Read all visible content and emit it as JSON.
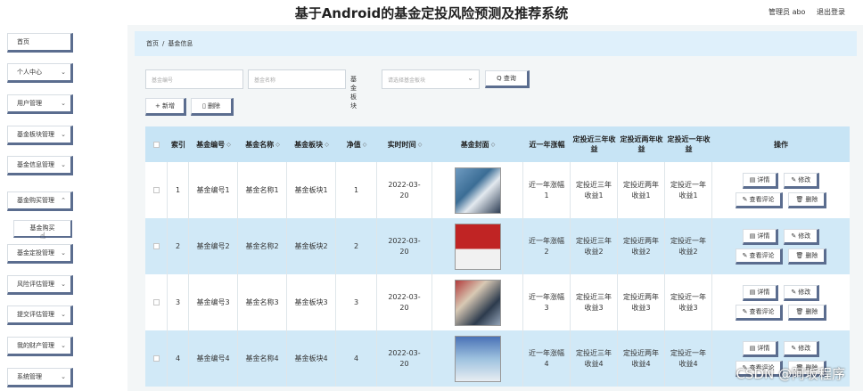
{
  "header": {
    "title": "基于Android的基金定投风险预测及推荐系统",
    "user_label": "管理员 abo",
    "logout_label": "退出登录"
  },
  "sidebar": {
    "items": [
      {
        "label": "首页"
      },
      {
        "label": "个人中心",
        "chevron": "⌄"
      },
      {
        "label": "用户管理",
        "chevron": "⌄"
      },
      {
        "label": "基金板块管理",
        "chevron": "⌄"
      },
      {
        "label": "基金信息管理",
        "chevron": "⌄"
      },
      {
        "label": "基金购买管理",
        "chevron": "⌃"
      },
      {
        "label": "基金定投管理",
        "chevron": "⌄"
      },
      {
        "label": "风险评估管理",
        "chevron": "⌄"
      },
      {
        "label": "提交评估管理",
        "chevron": "⌄"
      },
      {
        "label": "我的财产管理",
        "chevron": "⌄"
      },
      {
        "label": "系统管理",
        "chevron": "⌄"
      }
    ],
    "sub_item": "基金购买"
  },
  "breadcrumb": {
    "home": "首页",
    "sep": "/",
    "current": "基金信息"
  },
  "search": {
    "code_placeholder": "基金编号",
    "name_placeholder": "基金名称",
    "sector_label": "基金板块",
    "sector_placeholder": "请选择基金板块",
    "query_label": "Q 查询"
  },
  "actions": {
    "add_label": "+ 新增",
    "delete_label": "▯ 删除"
  },
  "table": {
    "headers": {
      "index": "索引",
      "code": "基金编号",
      "name": "基金名称",
      "sector": "基金板块",
      "nav": "净值",
      "time": "实时时间",
      "cover": "基金封面",
      "one_year": "近一年涨幅",
      "three_year": "定投近三年收益",
      "two_year": "定投近两年收益",
      "last_year": "定投近一年收益",
      "ops": "操作"
    },
    "sort_icon": "◇",
    "rows": [
      {
        "index": "1",
        "code": "基金编号1",
        "name": "基金名称1",
        "sector": "基金板块1",
        "nav": "1",
        "time": "2022-03-20",
        "one_year": "近一年涨幅1",
        "three_year": "定投近三年收益1",
        "two_year": "定投近两年收益1",
        "last_year": "定投近一年收益1"
      },
      {
        "index": "2",
        "code": "基金编号2",
        "name": "基金名称2",
        "sector": "基金板块2",
        "nav": "2",
        "time": "2022-03-20",
        "one_year": "近一年涨幅2",
        "three_year": "定投近三年收益2",
        "two_year": "定投近两年收益2",
        "last_year": "定投近一年收益2"
      },
      {
        "index": "3",
        "code": "基金编号3",
        "name": "基金名称3",
        "sector": "基金板块3",
        "nav": "3",
        "time": "2022-03-20",
        "one_year": "近一年涨幅3",
        "three_year": "定投近三年收益3",
        "two_year": "定投近两年收益3",
        "last_year": "定投近一年收益3"
      },
      {
        "index": "4",
        "code": "基金编号4",
        "name": "基金名称4",
        "sector": "基金板块4",
        "nav": "4",
        "time": "2022-03-20",
        "one_year": "近一年涨幅4",
        "three_year": "定投近三年收益4",
        "two_year": "定投近两年收益4",
        "last_year": "定投近一年收益4"
      }
    ],
    "ops": {
      "detail": "详情",
      "edit": "修改",
      "comments": "查看评论",
      "delete": "删除"
    }
  },
  "watermark": "CSDN @阿坂程序"
}
